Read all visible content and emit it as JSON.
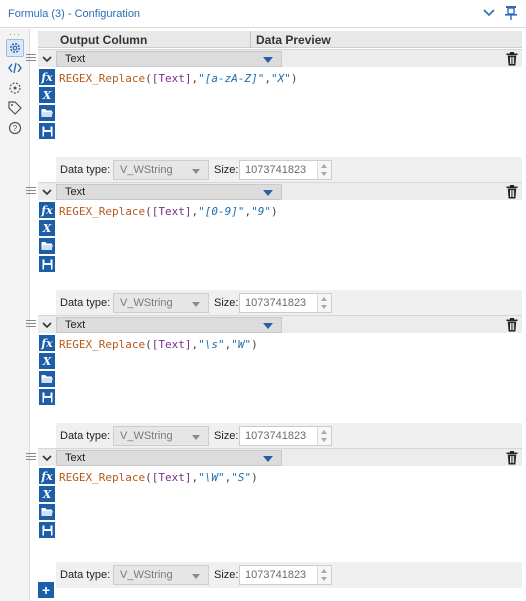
{
  "window": {
    "title": "Formula (3) - Configuration"
  },
  "rail": {
    "icons": [
      "gear-icon",
      "code-icon",
      "annotation-icon",
      "tag-icon",
      "help-icon"
    ]
  },
  "columns": {
    "output": "Output Column",
    "preview": "Data Preview"
  },
  "formulas": [
    {
      "output": "Text",
      "expr": {
        "fn": "REGEX_Replace",
        "field": "[Text]",
        "pattern": "\"[a-zA-Z]\"",
        "replacement": "\"X\""
      },
      "data_type_label": "Data type:",
      "data_type": "V_WString",
      "size_label": "Size:",
      "size": "1073741823"
    },
    {
      "output": "Text",
      "expr": {
        "fn": "REGEX_Replace",
        "field": "[Text]",
        "pattern": "\"[0-9]\"",
        "replacement": "\"9\""
      },
      "data_type_label": "Data type:",
      "data_type": "V_WString",
      "size_label": "Size:",
      "size": "1073741823"
    },
    {
      "output": "Text",
      "expr": {
        "fn": "REGEX_Replace",
        "field": "[Text]",
        "pattern": "\"\\s\"",
        "replacement": "\"W\""
      },
      "data_type_label": "Data type:",
      "data_type": "V_WString",
      "size_label": "Size:",
      "size": "1073741823"
    },
    {
      "output": "Text",
      "expr": {
        "fn": "REGEX_Replace",
        "field": "[Text]",
        "pattern": "\"\\W\"",
        "replacement": "\"S\""
      },
      "data_type_label": "Data type:",
      "data_type": "V_WString",
      "size_label": "Size:",
      "size": "1073741823"
    }
  ],
  "tool_icons": [
    "fx-icon",
    "variable-x-icon",
    "open-folder-icon",
    "save-icon"
  ],
  "add_button": "+",
  "colors": {
    "accent": "#1d5ea8",
    "title": "#2b6cb7"
  }
}
